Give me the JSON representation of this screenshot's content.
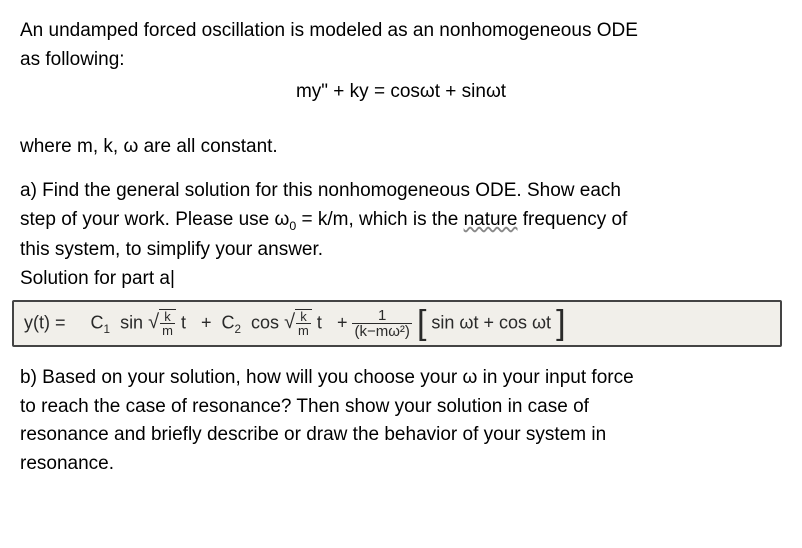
{
  "intro_line1": "An undamped forced oscillation is modeled as an nonhomogeneous ODE",
  "intro_line2": "as following:",
  "main_equation": "my\" + ky = cosωt + sinωt",
  "where_line": "where m, k, ω are all constant.",
  "part_a_l1": "a) Find the general solution for this nonhomogeneous ODE. Show each",
  "part_a_l2_pre": "step of your work. Please use ω",
  "part_a_l2_sub": "0",
  "part_a_l2_mid": " = k/m, which is the ",
  "part_a_l2_underlined": "nature",
  "part_a_l2_post": " frequency of",
  "part_a_l3": "this system, to simplify your answer.",
  "solution_label": "Solution for part a",
  "hw": {
    "lhs": "y(t) =",
    "c1": "C",
    "c1sub": "1",
    "sin": "sin",
    "frac_num": "k",
    "frac_den": "m",
    "t": "t",
    "plus": "+",
    "c2": "C",
    "c2sub": "2",
    "cos": "cos",
    "one": "1",
    "divisor": "(k−mω²)",
    "bracket_term": "sin ωt + cos ωt"
  },
  "part_b_l1": "b) Based on your solution, how will you choose your ω in your input force",
  "part_b_l2": "to reach the case of resonance? Then show your solution in case of",
  "part_b_l3": "resonance and briefly describe or draw the behavior of your system in",
  "part_b_l4": "resonance."
}
